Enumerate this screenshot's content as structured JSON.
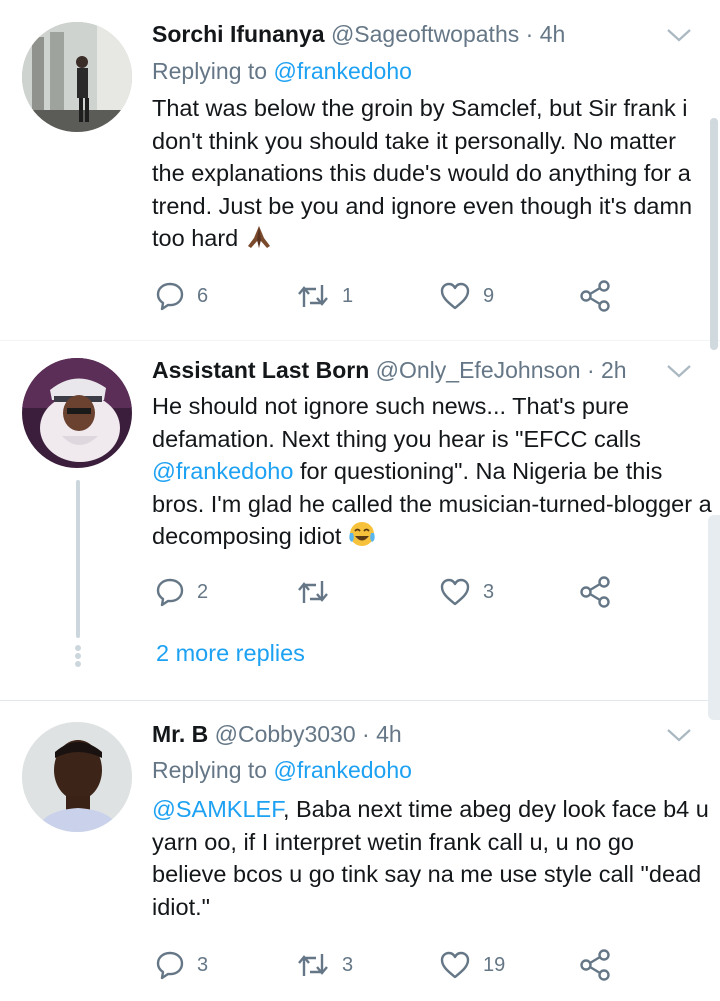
{
  "tweets": [
    {
      "name": "Sorchi Ifunanya",
      "handle": "@Sageoftwopaths",
      "time": "· 4h",
      "replying_label": "Replying to",
      "replying_to": "@frankedoho",
      "text": "That was below the groin by Samclef, but Sir frank i don't think you should take it personally. No matter the explanations this dude's would do anything for a trend. Just be you and ignore even though it's damn too hard",
      "emoji": "praying-hands",
      "replies": "6",
      "retweets": "1",
      "likes": "9"
    },
    {
      "name": "Assistant Last Born",
      "handle": "@Only_EfeJohnson",
      "time": "· 2h",
      "text_part1": "He should not ignore such news... That's pure defamation. Next thing you hear is \"EFCC calls",
      "mention": "@frankedoho",
      "text_part2": " for questioning\".  Na Nigeria be this bros. I'm glad he called the musician-turned-blogger  a decomposing idiot",
      "emoji": "tears-of-joy",
      "replies": "2",
      "retweets": "",
      "likes": "3"
    },
    {
      "name": "Mr. B",
      "handle": "@Cobby3030",
      "time": "· 4h",
      "replying_label": "Replying to",
      "replying_to": "@frankedoho",
      "mention": "@SAMKLEF",
      "text": ", Baba next time abeg dey look face b4 u yarn oo, if I interpret wetin frank call u, u no go believe bcos u go tink say na me use style call \"dead idiot.\"",
      "replies": "3",
      "retweets": "3",
      "likes": "19"
    }
  ],
  "more_replies": "2 more replies",
  "colors": {
    "text": "#14171a",
    "secondary": "#657786",
    "accent": "#1da1f2",
    "divider": "#e1e8ed"
  },
  "icons": [
    "reply-icon",
    "retweet-icon",
    "like-icon",
    "share-icon",
    "chevron-down-icon"
  ]
}
